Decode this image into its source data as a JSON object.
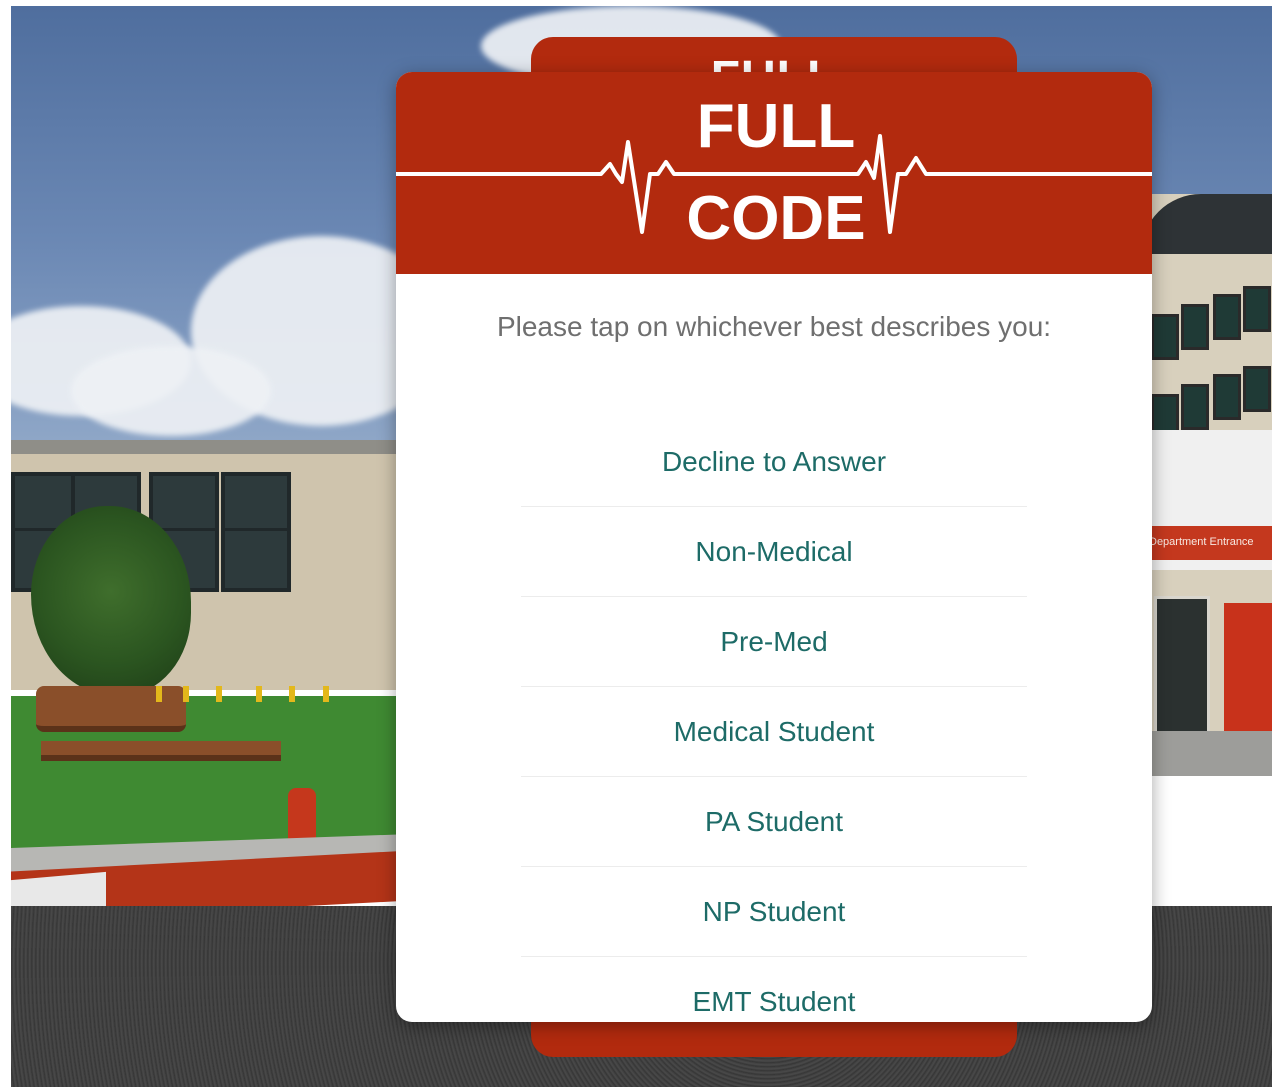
{
  "app": {
    "title_line1": "FULL",
    "title_line2": "CODE",
    "back_card_title": "FULL"
  },
  "background": {
    "sign_text": "Department Entrance"
  },
  "dialog": {
    "prompt": "Please tap on whichever best describes you:",
    "options": [
      {
        "label": "Decline to Answer"
      },
      {
        "label": "Non-Medical"
      },
      {
        "label": "Pre-Med"
      },
      {
        "label": "Medical Student"
      },
      {
        "label": "PA Student"
      },
      {
        "label": "NP Student"
      },
      {
        "label": "EMT Student"
      }
    ]
  },
  "colors": {
    "brand_red": "#b22a0e",
    "option_text": "#1d6b67",
    "prompt_text": "#6f6f6f"
  },
  "icons": [
    "heartbeat-icon"
  ]
}
